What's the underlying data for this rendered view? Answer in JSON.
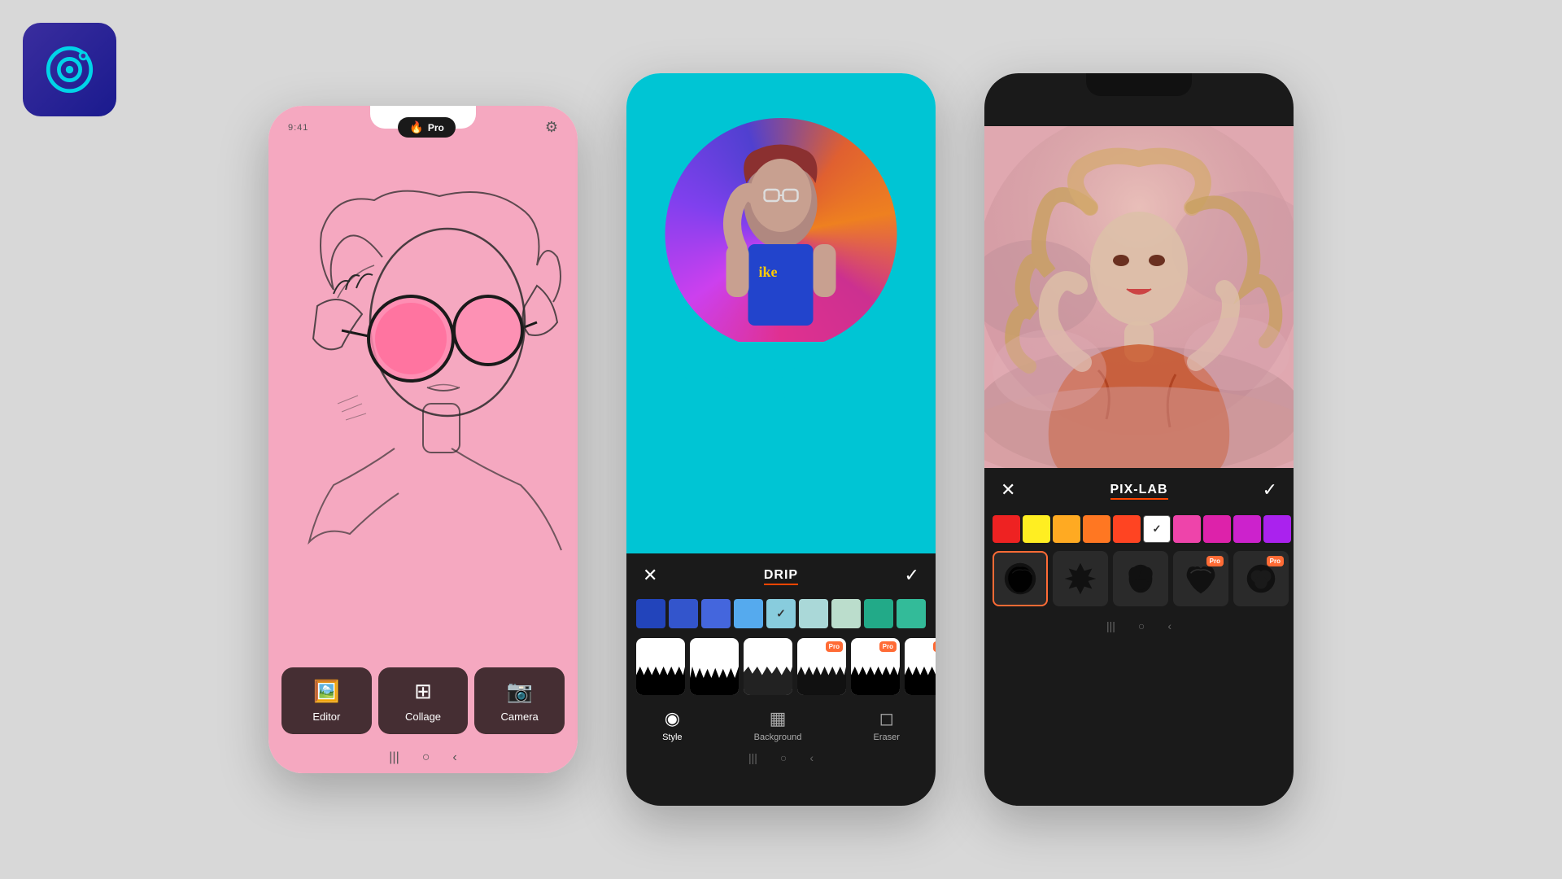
{
  "app": {
    "logo_alt": "PicsArt app logo"
  },
  "phone1": {
    "time": "9:41",
    "pro_label": "Pro",
    "nav_items": [
      {
        "id": "editor",
        "label": "Editor",
        "icon": "🖼️"
      },
      {
        "id": "collage",
        "label": "Collage",
        "icon": "⊞"
      },
      {
        "id": "camera",
        "label": "Camera",
        "icon": "📷"
      }
    ]
  },
  "phone2": {
    "toolbar": {
      "title": "DRIP",
      "close_label": "✕",
      "check_label": "✓"
    },
    "colors": [
      "#2244bb",
      "#3355cc",
      "#4466dd",
      "#55aaee",
      "#66ccff",
      "#77ddee",
      "#aacccc",
      "#bbddcc",
      "#22aa88",
      "#33bb99"
    ],
    "selected_color_index": 6,
    "tabs": [
      {
        "id": "style",
        "label": "Style",
        "icon": "◉",
        "active": true
      },
      {
        "id": "background",
        "label": "Background",
        "icon": "▦",
        "active": false
      },
      {
        "id": "eraser",
        "label": "Eraser",
        "icon": "◻",
        "active": false
      }
    ]
  },
  "phone3": {
    "toolbar": {
      "title": "PIX-LAB",
      "close_label": "✕",
      "check_label": "✓"
    },
    "colors": [
      "#ee2222",
      "#ffee22",
      "#ffaa22",
      "#ff7722",
      "#ff4422",
      "#ffffff",
      "#ee44aa",
      "#dd22aa",
      "#cc22cc",
      "#aa22ee",
      "#9922ff"
    ],
    "selected_color_index": 6,
    "brushes": [
      {
        "id": "brush1",
        "label": "",
        "selected": true
      },
      {
        "id": "brush2",
        "label": ""
      },
      {
        "id": "brush3",
        "label": ""
      },
      {
        "id": "brush4",
        "label": "",
        "pro": true
      },
      {
        "id": "brush5",
        "label": "",
        "pro": true
      }
    ]
  },
  "colors": {
    "phone1_bg": "#f5a8c0",
    "phone2_bg": "#00c5d4",
    "brand_orange": "#ff4500",
    "pro_bg": "#ff6b35"
  }
}
